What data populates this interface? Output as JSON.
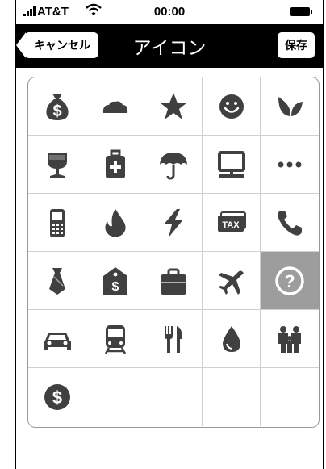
{
  "status": {
    "carrier": "AT&T",
    "time": "00:00"
  },
  "nav": {
    "title": "アイコン",
    "cancel_label": "キャンセル",
    "save_label": "保存"
  },
  "grid": {
    "selected_index": 19,
    "icons": [
      {
        "name": "money-bag-icon",
        "text": "$"
      },
      {
        "name": "bread-icon"
      },
      {
        "name": "star-icon"
      },
      {
        "name": "smiley-icon"
      },
      {
        "name": "leaf-icon"
      },
      {
        "name": "wine-glass-icon"
      },
      {
        "name": "first-aid-kit-icon"
      },
      {
        "name": "umbrella-icon"
      },
      {
        "name": "computer-icon"
      },
      {
        "name": "ellipsis-icon"
      },
      {
        "name": "mobile-phone-icon"
      },
      {
        "name": "fire-icon"
      },
      {
        "name": "lightning-icon"
      },
      {
        "name": "tax-ticket-icon",
        "text": "TAX"
      },
      {
        "name": "telephone-icon"
      },
      {
        "name": "necktie-icon"
      },
      {
        "name": "price-tag-icon",
        "text": "$"
      },
      {
        "name": "briefcase-icon"
      },
      {
        "name": "airplane-icon"
      },
      {
        "name": "question-icon",
        "text": "?"
      },
      {
        "name": "car-icon"
      },
      {
        "name": "train-icon"
      },
      {
        "name": "fork-knife-icon"
      },
      {
        "name": "water-drop-icon"
      },
      {
        "name": "family-icon"
      },
      {
        "name": "coin-icon",
        "text": "$"
      }
    ],
    "empty_cells": 4
  }
}
